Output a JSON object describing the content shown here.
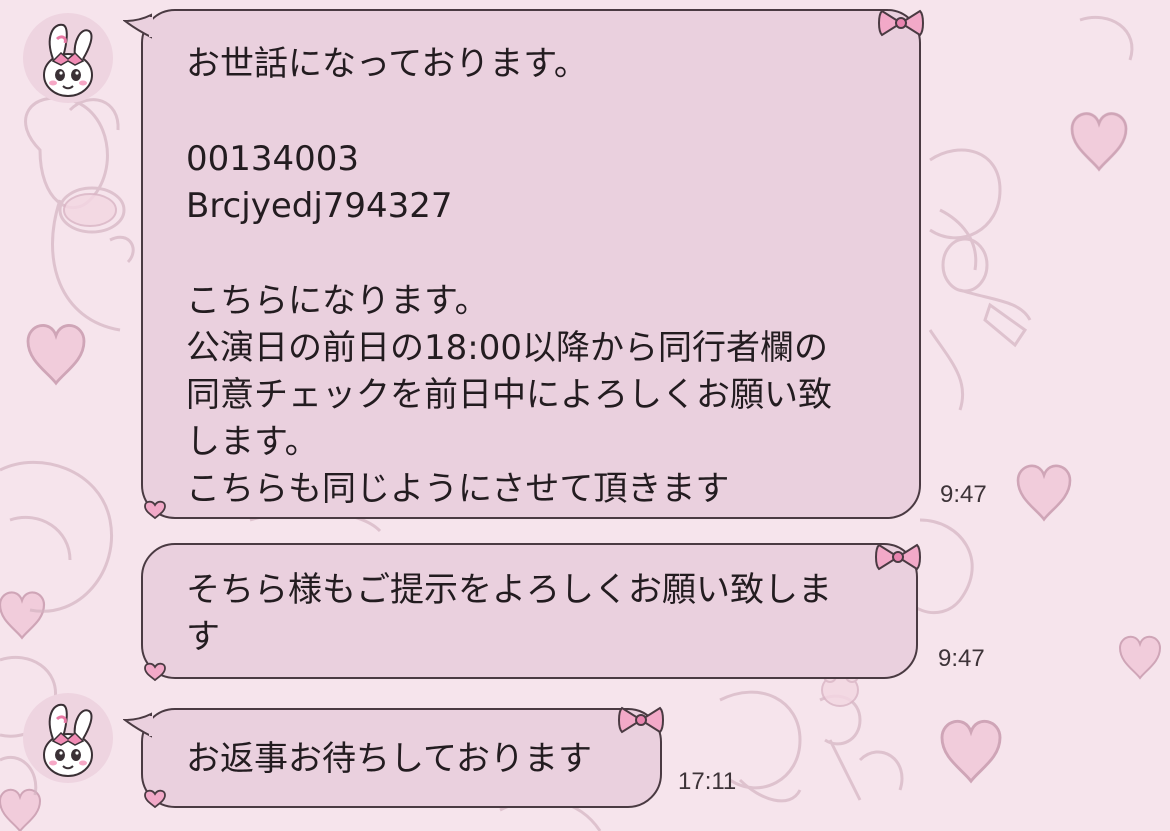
{
  "messages": [
    {
      "lines": [
        "お世話になっております。",
        "",
        "00134003",
        "Brcjyedj794327",
        "",
        "こちらになります。",
        "公演日の前日の18:00以降から同行者欄の",
        "同意チェックを前日中によろしくお願い致",
        "します。",
        "こちらも同じようにさせて頂きます"
      ],
      "time": "9:47"
    },
    {
      "lines": [
        "そちら様もご提示をよろしくお願い致しま",
        "す"
      ],
      "time": "9:47"
    },
    {
      "lines": [
        "お返事お待ちしております"
      ],
      "time": "17:11"
    }
  ],
  "colors": {
    "background": "#f6e4ec",
    "bubble": "#ead0de",
    "bubble_border": "#4a3a42",
    "accent_bow": "#f2a9c8"
  },
  "icons": {
    "avatar": "bunny-avatar-icon",
    "bow": "ribbon-bow-icon",
    "heart": "heart-icon"
  }
}
